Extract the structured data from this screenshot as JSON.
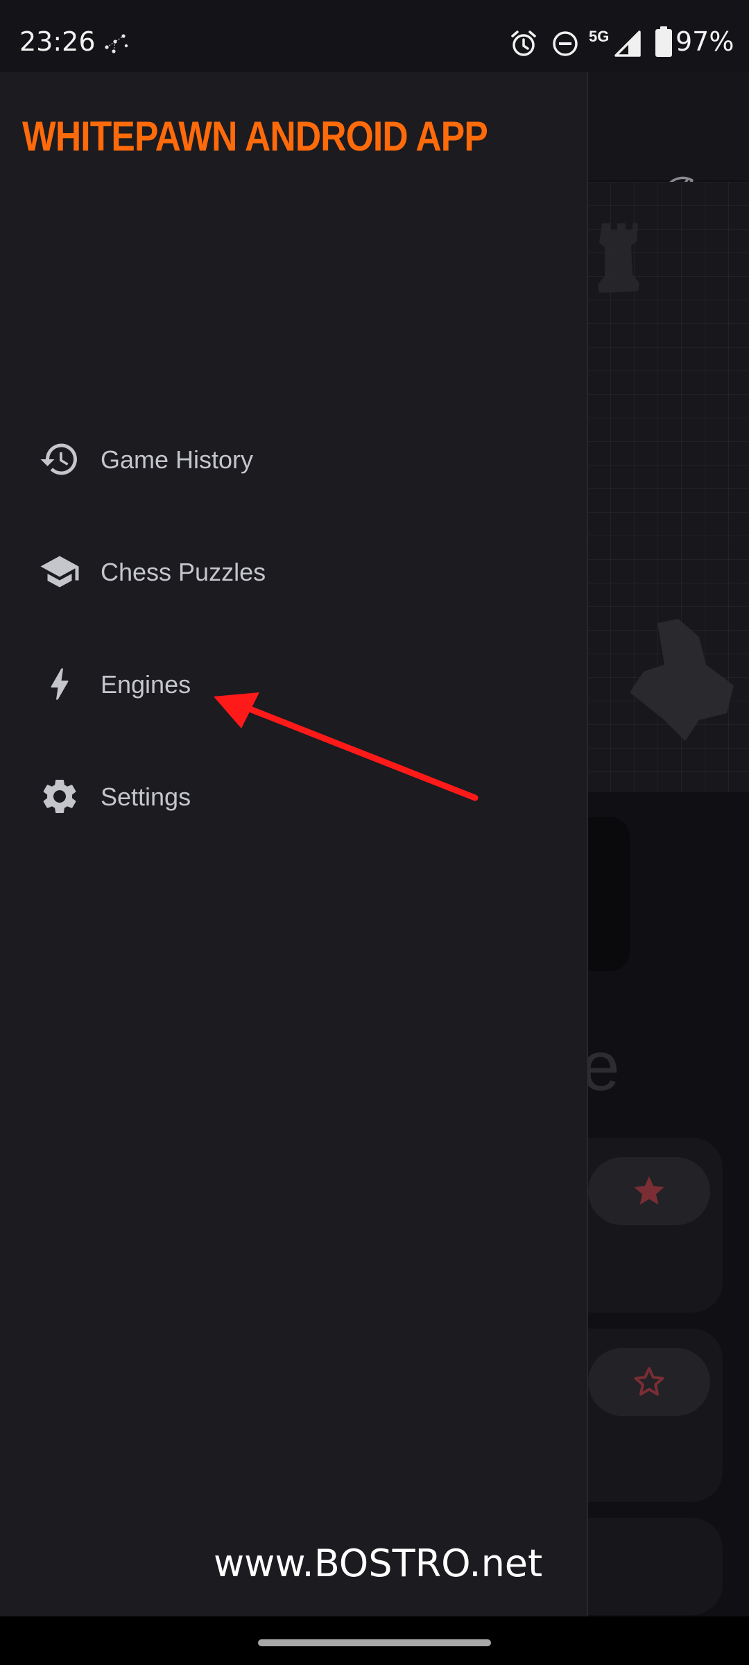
{
  "status_bar": {
    "time": "23:26",
    "network": "5G",
    "battery": "97%",
    "icons": [
      "constellation-icon",
      "alarm-icon",
      "do-not-disturb-icon",
      "signal-icon",
      "battery-icon"
    ]
  },
  "drawer": {
    "title": "WHITEPAWN ANDROID APP",
    "title_color": "#ff6a0a",
    "items": [
      {
        "label": "Game History",
        "icon": "history-icon"
      },
      {
        "label": "Chess Puzzles",
        "icon": "school-icon"
      },
      {
        "label": "Engines",
        "icon": "bolt-icon"
      },
      {
        "label": "Settings",
        "icon": "gear-icon"
      }
    ]
  },
  "background_app": {
    "partial_heading": "e",
    "icons": [
      "knight-logo-icon",
      "star-filled-icon",
      "star-outline-icon"
    ]
  },
  "annotation": {
    "arrow_color": "#ff1a1a",
    "points_to": "Engines"
  },
  "watermark": "www.BOSTRO.net"
}
